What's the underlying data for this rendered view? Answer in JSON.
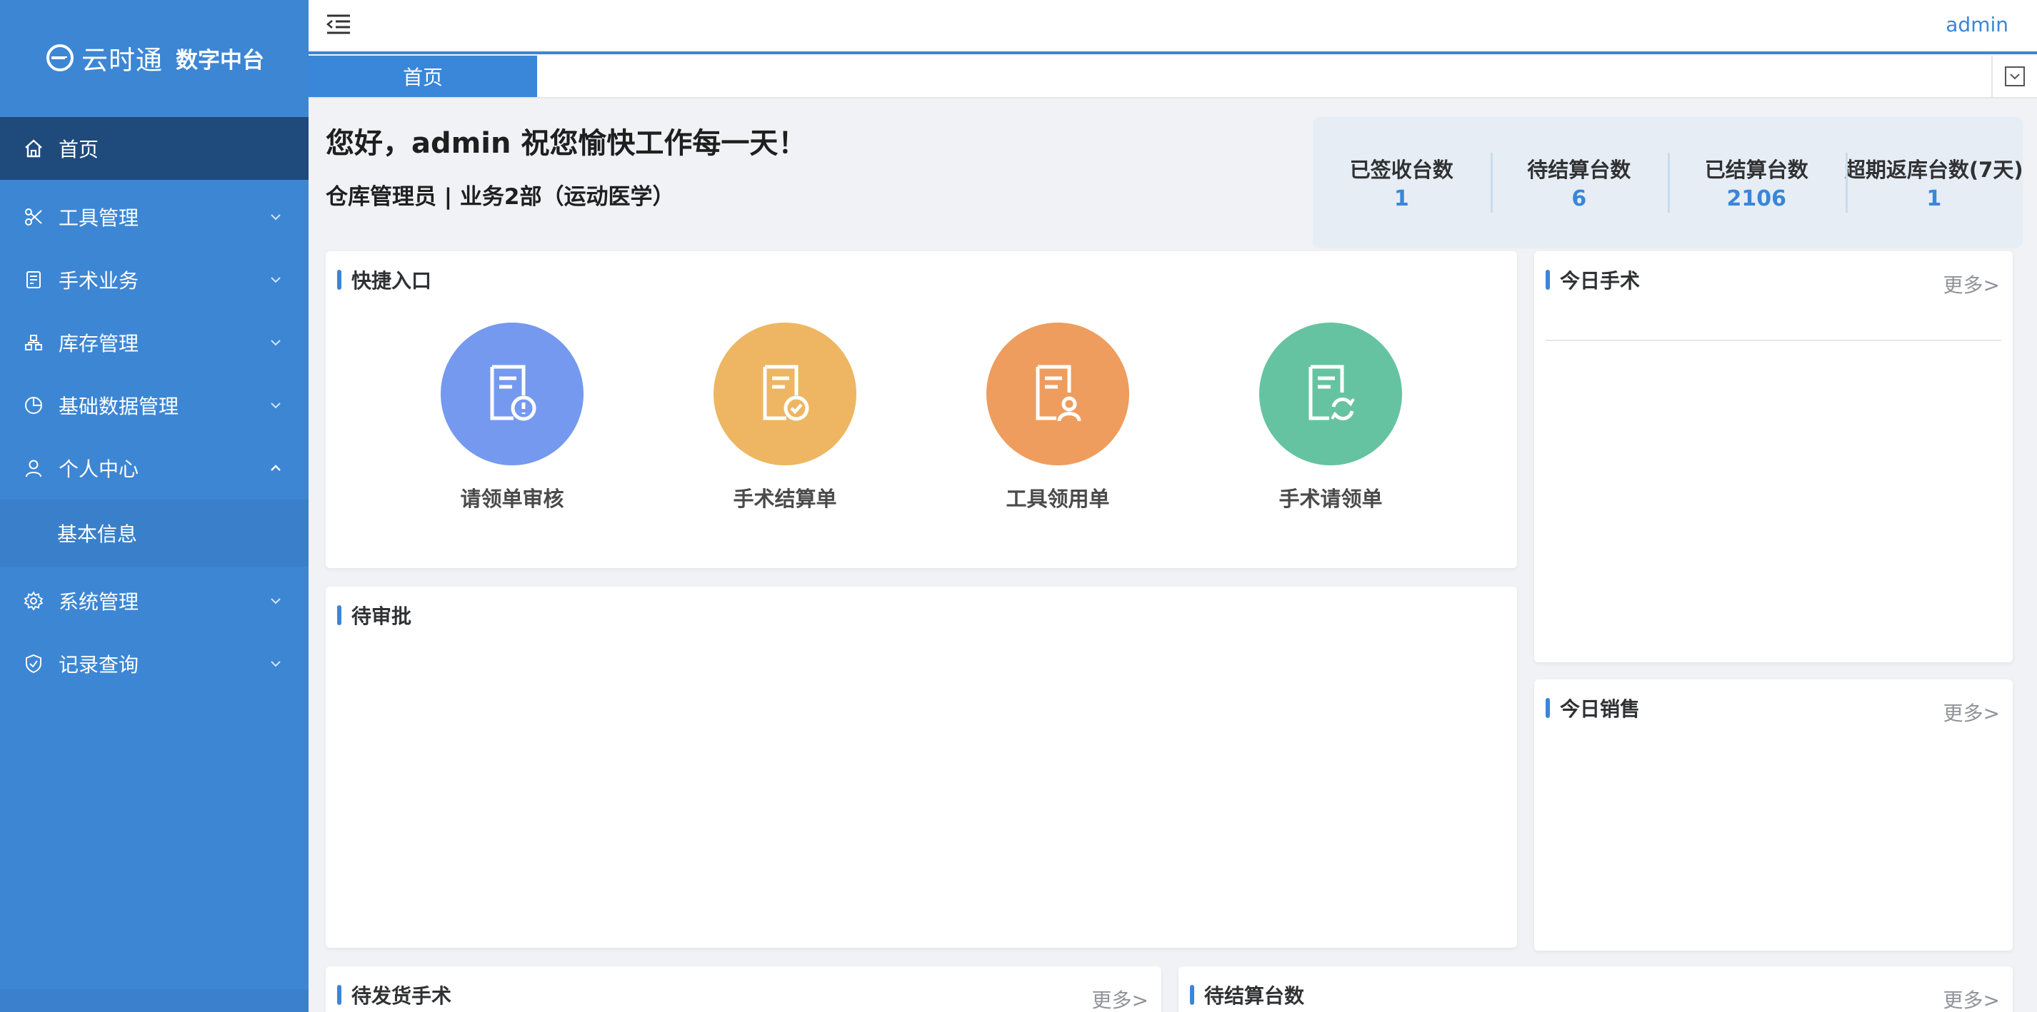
{
  "brand": {
    "name": "云时通",
    "subtitle": "数字中台"
  },
  "sidebar": {
    "items": [
      {
        "label": "首页",
        "icon": "home-icon",
        "state": "active"
      },
      {
        "label": "工具管理",
        "icon": "scissors-icon",
        "state": "collapsed"
      },
      {
        "label": "手术业务",
        "icon": "document-icon",
        "state": "collapsed"
      },
      {
        "label": "库存管理",
        "icon": "warehouse-icon",
        "state": "collapsed"
      },
      {
        "label": "基础数据管理",
        "icon": "pie-chart-icon",
        "state": "collapsed"
      },
      {
        "label": "个人中心",
        "icon": "user-icon",
        "state": "expanded"
      },
      {
        "label": "系统管理",
        "icon": "gear-icon",
        "state": "collapsed"
      },
      {
        "label": "记录查询",
        "icon": "shield-icon",
        "state": "collapsed"
      }
    ],
    "sub_items": [
      {
        "label": "基本信息"
      }
    ]
  },
  "header": {
    "user": "admin"
  },
  "tabs": [
    {
      "label": "首页",
      "active": true
    }
  ],
  "greeting": {
    "title": "您好，admin 祝您愉快工作每一天！",
    "subtitle": "仓库管理员 | 业务2部（运动医学）"
  },
  "stats": [
    {
      "label": "已签收台数",
      "value": "1"
    },
    {
      "label": "待结算台数",
      "value": "6"
    },
    {
      "label": "已结算台数",
      "value": "2106"
    },
    {
      "label": "超期返库台数(7天)",
      "value": "1"
    }
  ],
  "quick_entry": {
    "title": "快捷入口",
    "items": [
      {
        "label": "请领单审核",
        "icon": "doc-alert-icon",
        "color": "#7599ee"
      },
      {
        "label": "手术结算单",
        "icon": "doc-check-icon",
        "color": "#eeb662"
      },
      {
        "label": "工具领用单",
        "icon": "doc-user-icon",
        "color": "#ee9d5e"
      },
      {
        "label": "手术请领单",
        "icon": "doc-refresh-icon",
        "color": "#66c3a1"
      }
    ]
  },
  "panels": {
    "today_surgery": {
      "title": "今日手术",
      "more": "更多>"
    },
    "pending_approval": {
      "title": "待审批"
    },
    "today_sales": {
      "title": "今日销售",
      "more": "更多>"
    },
    "pending_shipment": {
      "title": "待发货手术",
      "more": "更多>"
    },
    "pending_settlement": {
      "title": "待结算台数",
      "more": "更多>"
    }
  },
  "colors": {
    "sidebar_bg": "#3d86d4",
    "sidebar_active": "#1f4a7c",
    "accent": "#3a86d8",
    "stats_bg": "#e6edf4"
  }
}
